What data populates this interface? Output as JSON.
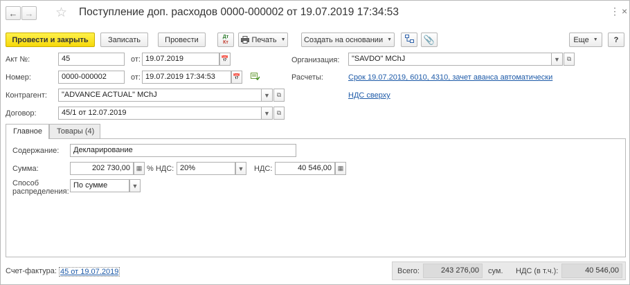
{
  "header": {
    "title": "Поступление доп. расходов 0000-000002 от 19.07.2019 17:34:53",
    "more_glyph": "⋮",
    "close_glyph": "×"
  },
  "toolbar": {
    "post_and_close": "Провести и закрыть",
    "save": "Записать",
    "post": "Провести",
    "dt_kt_top": "Дт",
    "dt_kt_bottom": "Кт",
    "print": "Печать",
    "create_based_on": "Создать на основании",
    "more": "Еще",
    "help": "?"
  },
  "form": {
    "akt_label": "Акт №:",
    "akt_value": "45",
    "ot_label_1": "от:",
    "akt_date": "19.07.2019",
    "number_label": "Номер:",
    "number_value": "0000-000002",
    "ot_label_2": "от:",
    "number_date": "19.07.2019 17:34:53",
    "counterparty_label": "Контрагент:",
    "counterparty_value": "\"ADVANCE ACTUAL\" MChJ",
    "contract_label": "Договор:",
    "contract_value": "45/1 от 12.07.2019",
    "org_label": "Организация:",
    "org_value": "\"SAVDO\" MChJ",
    "settlements_label": "Расчеты:",
    "settlements_link": "Срок 19.07.2019, 6010, 4310, зачет аванса автоматически",
    "vat_link": "НДС сверху"
  },
  "tabs": [
    {
      "label": "Главное",
      "active": true
    },
    {
      "label": "Товары (4)",
      "active": false
    }
  ],
  "main": {
    "content_label": "Содержание:",
    "content_value": "Декларирование",
    "sum_label": "Сумма:",
    "sum_value": "202 730,00",
    "vat_rate_label": "% НДС:",
    "vat_rate_value": "20%",
    "vat_label": "НДС:",
    "vat_value": "40 546,00",
    "method_label_1": "Способ",
    "method_label_2": "распределения:",
    "method_value": "По сумме"
  },
  "footer": {
    "invoice_label": "Счет-фактура:",
    "invoice_link": "45 от 19.07.2019",
    "total_label": "Всего:",
    "total_value": "243 276,00",
    "currency": "сум.",
    "vat_incl_label": "НДС (в т.ч.):",
    "vat_incl_value": "40 546,00"
  }
}
